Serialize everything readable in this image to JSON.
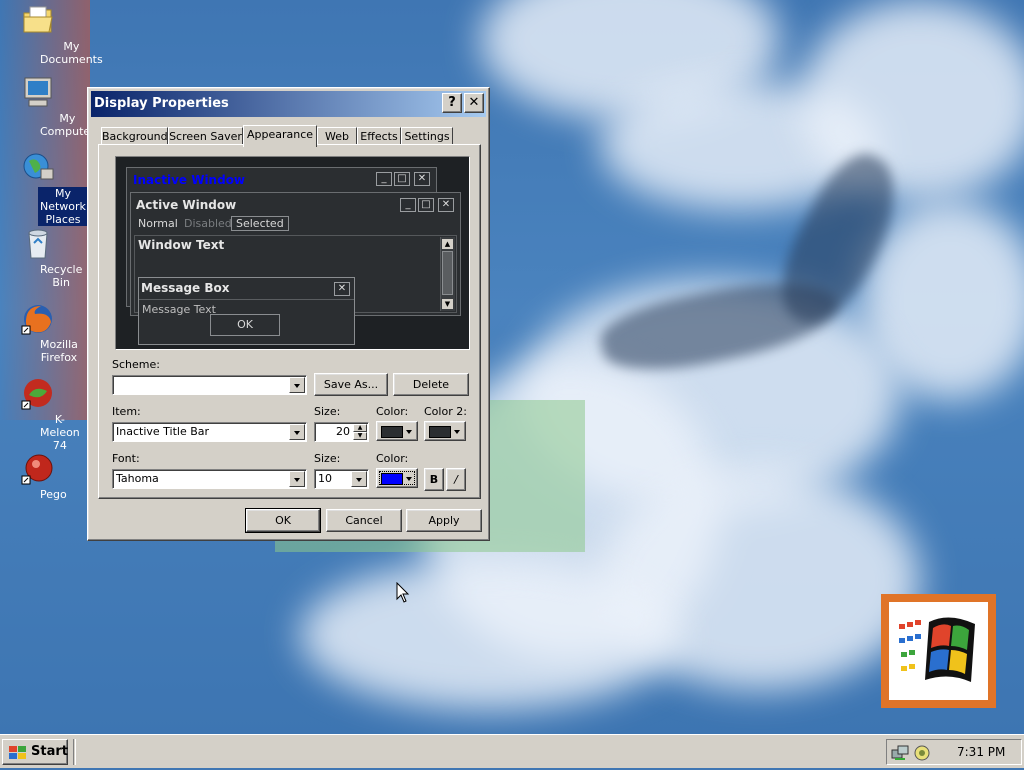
{
  "desktop": {
    "icons": [
      {
        "label": "My Documents"
      },
      {
        "label": "My Computer"
      },
      {
        "label": "My Network Places"
      },
      {
        "label": "Recycle Bin"
      },
      {
        "label": "Mozilla Firefox"
      },
      {
        "label": "K-Meleon 74"
      },
      {
        "label": "Pego"
      }
    ]
  },
  "dialog": {
    "title": "Display Properties",
    "help_label": "?",
    "close_label": "✕",
    "tabs": [
      "Background",
      "Screen Saver",
      "Appearance",
      "Web",
      "Effects",
      "Settings"
    ],
    "active_tab": "Appearance",
    "preview": {
      "inactive_title": "Inactive Window",
      "active_title": "Active Window",
      "menu": [
        "Normal",
        "Disabled",
        "Selected"
      ],
      "window_text": "Window Text",
      "msgbox_title": "Message Box",
      "msgbox_text": "Message Text",
      "ok_label": "OK"
    },
    "scheme_label": "Scheme:",
    "scheme_value": "",
    "save_as_label": "Save As...",
    "delete_label": "Delete",
    "item_label": "Item:",
    "item_value": "Inactive Title Bar",
    "item_size_label": "Size:",
    "item_size_value": "20",
    "item_color_label": "Color:",
    "item_color2_label": "Color 2:",
    "font_label": "Font:",
    "font_value": "Tahoma",
    "font_size_label": "Size:",
    "font_size_value": "10",
    "font_color_label": "Color:",
    "bold_label": "B",
    "italic_label": "/",
    "ok_label": "OK",
    "cancel_label": "Cancel",
    "apply_label": "Apply"
  },
  "taskbar": {
    "start_label": "Start",
    "clock": "7:31 PM"
  },
  "colors": {
    "inactive_title_text": "#0000ff",
    "item_color": "#2b2e31",
    "item_color2": "#2b2e31",
    "font_color": "#0000ff"
  }
}
